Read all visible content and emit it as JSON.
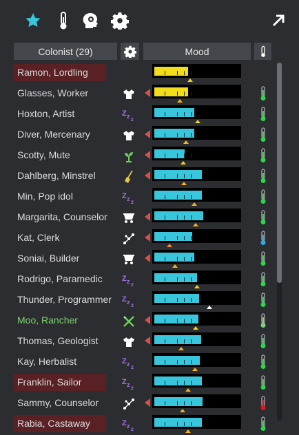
{
  "header": {
    "colonist_label": "Colonist (29)",
    "mood_label": "Mood"
  },
  "icons": {
    "favorite": "star-icon",
    "temperature": "thermometer-icon",
    "mood": "head-gear-icon",
    "settings": "gear-icon",
    "expand": "arrow-up-right-icon"
  },
  "colors": {
    "accent": "#38c6dd",
    "mood_bar": "#38c6dd",
    "mood_bar_low": "#f3dc1a",
    "highlight_row": "#5a2125",
    "temp_ok": "#2fd64a",
    "temp_cold": "#2fa8e6",
    "temp_hot": "#e5141a"
  },
  "colonists": [
    {
      "name": "Ramon, Lordling",
      "highlight": true,
      "job_icon": "none",
      "mood": 0.4,
      "target": 0.42,
      "low": true,
      "temp": "none"
    },
    {
      "name": "Glasses, Worker",
      "highlight": false,
      "job_icon": "shirt-icon",
      "mood": 0.4,
      "target": 0.3,
      "low": true,
      "temp": "ok"
    },
    {
      "name": "Hoxton, Artist",
      "highlight": false,
      "job_icon": "sleep-icon",
      "mood": 0.47,
      "target": 0.51,
      "low": false,
      "temp": "ok"
    },
    {
      "name": "Diver, Mercenary",
      "highlight": false,
      "job_icon": "shirt-icon",
      "mood": 0.47,
      "target": 0.37,
      "low": false,
      "temp": "ok"
    },
    {
      "name": "Scotty, Mute",
      "highlight": false,
      "job_icon": "plant-icon",
      "mood": 0.36,
      "target": 0.34,
      "low": false,
      "temp": "ok"
    },
    {
      "name": "Dahlberg, Minstrel",
      "highlight": false,
      "job_icon": "broom-icon",
      "mood": 0.56,
      "target": 0.35,
      "low": false,
      "temp": "ok"
    },
    {
      "name": "Min, Pop idol",
      "highlight": false,
      "job_icon": "sleep-icon",
      "mood": 0.56,
      "target": 0.47,
      "low": false,
      "temp": "ok"
    },
    {
      "name": "Margarita, Counselor",
      "highlight": false,
      "job_icon": "cart-icon",
      "mood": 0.58,
      "target": 0.49,
      "low": false,
      "temp": "ok"
    },
    {
      "name": "Kat, Clerk",
      "highlight": false,
      "job_icon": "network-icon",
      "mood": 0.45,
      "target": 0.18,
      "low": false,
      "temp": "cold"
    },
    {
      "name": "Soniai, Builder",
      "highlight": false,
      "job_icon": "cart-icon",
      "mood": 0.47,
      "target": 0.24,
      "low": false,
      "temp": "ok"
    },
    {
      "name": "Rodrigo, Paramedic",
      "highlight": false,
      "job_icon": "sleep-icon",
      "mood": 0.5,
      "target": 0.5,
      "low": false,
      "temp": "ok"
    },
    {
      "name": "Thunder, Programmer",
      "highlight": false,
      "job_icon": "sleep-icon",
      "mood": 0.53,
      "target": 0.65,
      "low": false,
      "temp": "ok"
    },
    {
      "name": "Moo, Rancher",
      "highlight": false,
      "green_name": true,
      "job_icon": "cross-tools-icon",
      "mood": 0.52,
      "target": 0.49,
      "low": false,
      "temp": "ok-light"
    },
    {
      "name": "Thomas, Geologist",
      "highlight": false,
      "job_icon": "shirt-icon",
      "mood": 0.55,
      "target": 0.32,
      "low": false,
      "temp": "ok"
    },
    {
      "name": "Kay, Herbalist",
      "highlight": false,
      "job_icon": "sleep-icon",
      "mood": 0.54,
      "target": 0.48,
      "low": false,
      "temp": "ok"
    },
    {
      "name": "Franklin, Sailor",
      "highlight": true,
      "job_icon": "sleep-icon",
      "mood": 0.56,
      "target": 0.4,
      "low": false,
      "temp": "ok"
    },
    {
      "name": "Sammy, Counselor",
      "highlight": false,
      "job_icon": "network-icon",
      "mood": 0.57,
      "target": 0.33,
      "low": false,
      "temp": "hot"
    },
    {
      "name": "Rabia, Castaway",
      "highlight": true,
      "job_icon": "sleep-icon",
      "mood": 0.56,
      "target": 0.4,
      "low": false,
      "temp": "ok"
    }
  ]
}
